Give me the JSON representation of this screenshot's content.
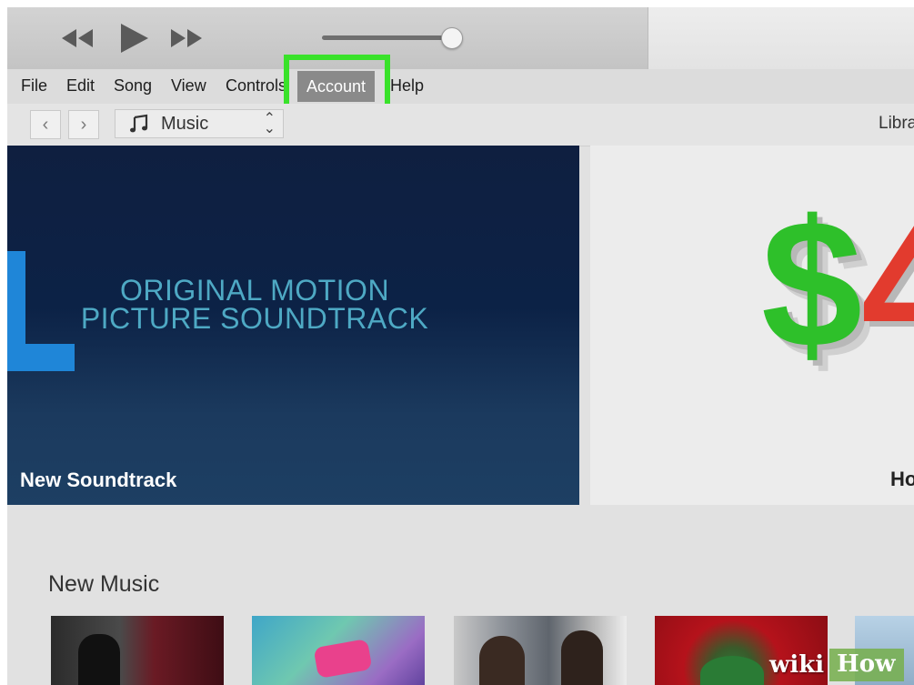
{
  "player": {
    "controls": [
      "rewind-icon",
      "play-icon",
      "fast-forward-icon"
    ],
    "volume_level": 0.95
  },
  "menu": {
    "items": [
      "File",
      "Edit",
      "Song",
      "View",
      "Controls",
      "Account",
      "Help"
    ],
    "highlighted": "Account",
    "highlight_color": "#39e22a"
  },
  "toolbar": {
    "back_glyph": "‹",
    "forward_glyph": "›",
    "media_type": "Music",
    "media_icon": "music-note-icon",
    "chevron_up": "⌃",
    "chevron_down": "⌄",
    "library_label": "Libra"
  },
  "banners": {
    "left": {
      "headline_line1": "ORIGINAL MOTION",
      "headline_line2": "PICTURE SOUNDTRACK",
      "caption": "New Soundtrack"
    },
    "right": {
      "glyph_1": "$",
      "glyph_2": "4",
      "caption": "Ho"
    }
  },
  "new_music": {
    "title": "New Music",
    "album_count_visible": 5
  },
  "watermark": {
    "part1": "wiki",
    "part2": "How"
  }
}
